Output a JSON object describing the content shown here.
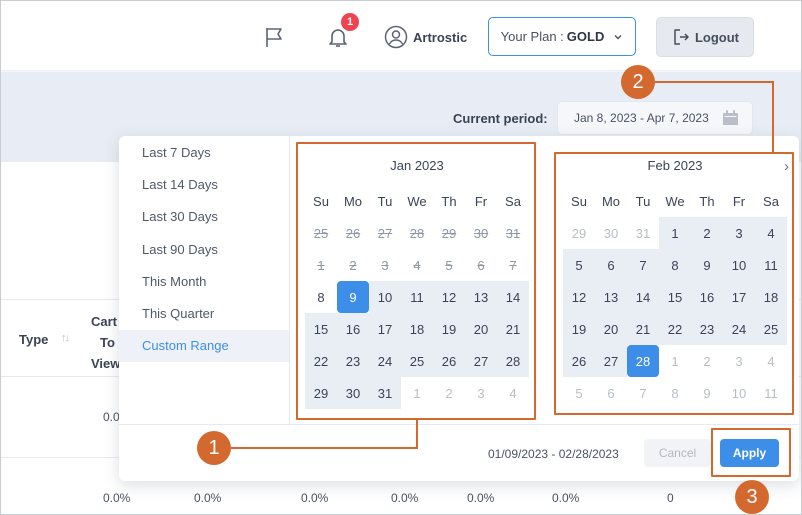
{
  "header": {
    "notification_count": "1",
    "username": "Artrostic",
    "plan_prefix": "Your Plan : ",
    "plan_value": "GOLD",
    "logout_label": "Logout"
  },
  "period": {
    "label": "Current period:",
    "value": "Jan 8, 2023 - Apr 7, 2023"
  },
  "table": {
    "col_type": "Type",
    "col_cart": [
      "Cart",
      "To",
      "View"
    ],
    "row1_value": "0.0",
    "row2_values": [
      "0.0%",
      "0.0%",
      "0.0%",
      "0.0%",
      "0.0%",
      "0.0%",
      "0"
    ]
  },
  "ranges": [
    "Last 7 Days",
    "Last 14 Days",
    "Last 30 Days",
    "Last 90 Days",
    "This Month",
    "This Quarter",
    "Custom Range"
  ],
  "active_range": "Custom Range",
  "calendars": [
    {
      "title": "Jan 2023",
      "weekdays": [
        "Su",
        "Mo",
        "Tu",
        "We",
        "Th",
        "Fr",
        "Sa"
      ],
      "weeks": [
        [
          "25",
          "26",
          "27",
          "28",
          "29",
          "30",
          "31"
        ],
        [
          "1",
          "2",
          "3",
          "4",
          "5",
          "6",
          "7"
        ],
        [
          "8",
          "9",
          "10",
          "11",
          "12",
          "13",
          "14"
        ],
        [
          "15",
          "16",
          "17",
          "18",
          "19",
          "20",
          "21"
        ],
        [
          "22",
          "23",
          "24",
          "25",
          "26",
          "27",
          "28"
        ],
        [
          "29",
          "30",
          "31",
          "1",
          "2",
          "3",
          "4"
        ]
      ],
      "states": [
        [
          "struck",
          "struck",
          "struck",
          "struck",
          "struck",
          "struck",
          "struck"
        ],
        [
          "struck",
          "struck",
          "struck",
          "struck",
          "struck",
          "struck",
          "struck"
        ],
        [
          "normal",
          "start",
          "range",
          "range",
          "range",
          "range",
          "range"
        ],
        [
          "range",
          "range",
          "range",
          "range",
          "range",
          "range",
          "range"
        ],
        [
          "range",
          "range",
          "range",
          "range",
          "range",
          "range",
          "range"
        ],
        [
          "range",
          "range",
          "range",
          "off",
          "off",
          "off",
          "off"
        ]
      ]
    },
    {
      "title": "Feb 2023",
      "next_label": "›",
      "weekdays": [
        "Su",
        "Mo",
        "Tu",
        "We",
        "Th",
        "Fr",
        "Sa"
      ],
      "weeks": [
        [
          "29",
          "30",
          "31",
          "1",
          "2",
          "3",
          "4"
        ],
        [
          "5",
          "6",
          "7",
          "8",
          "9",
          "10",
          "11"
        ],
        [
          "12",
          "13",
          "14",
          "15",
          "16",
          "17",
          "18"
        ],
        [
          "19",
          "20",
          "21",
          "22",
          "23",
          "24",
          "25"
        ],
        [
          "26",
          "27",
          "28",
          "1",
          "2",
          "3",
          "4"
        ],
        [
          "5",
          "6",
          "7",
          "8",
          "9",
          "10",
          "11"
        ]
      ],
      "states": [
        [
          "off",
          "off",
          "off",
          "range",
          "range",
          "range",
          "range"
        ],
        [
          "range",
          "range",
          "range",
          "range",
          "range",
          "range",
          "range"
        ],
        [
          "range",
          "range",
          "range",
          "range",
          "range",
          "range",
          "range"
        ],
        [
          "range",
          "range",
          "range",
          "range",
          "range",
          "range",
          "range"
        ],
        [
          "range",
          "range",
          "end",
          "off",
          "off",
          "off",
          "off"
        ],
        [
          "off",
          "off",
          "off",
          "off",
          "off",
          "off",
          "off"
        ]
      ]
    }
  ],
  "footer": {
    "selected_range": "01/09/2023 - 02/28/2023",
    "cancel_label": "Cancel",
    "apply_label": "Apply"
  },
  "annotations": [
    "1",
    "2",
    "3"
  ],
  "colors": {
    "accent": "#3d8ee8",
    "annotation": "#d4692f",
    "badge": "#ef4350"
  }
}
